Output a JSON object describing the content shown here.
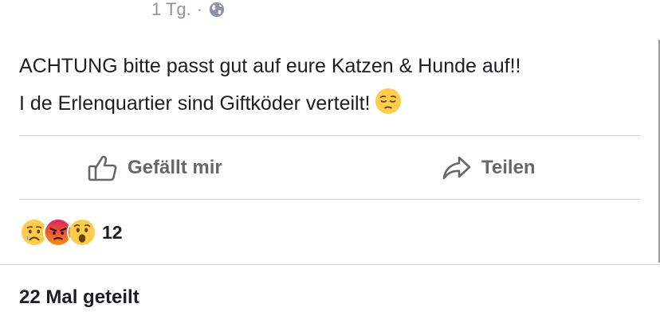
{
  "post": {
    "time": "1 Tg.",
    "separator": "·",
    "privacy_icon": "globe-icon",
    "text_line1": "ACHTUNG bitte passt gut auf eure Katzen & Hunde auf!!",
    "text_line2": "I de Erlenquartier sind Giftköder verteilt!",
    "text_emoji": "pensive-face-emoji"
  },
  "actions": {
    "like_label": "Gefällt mir",
    "like_icon": "thumbs-up-icon",
    "share_label": "Teilen",
    "share_icon": "share-arrow-icon"
  },
  "reactions": {
    "icons": [
      "sad-reaction",
      "angry-reaction",
      "wow-reaction"
    ],
    "count": "12"
  },
  "shares": {
    "label": "22 Mal geteilt"
  },
  "colors": {
    "text": "#1c1e21",
    "secondary": "#65676b",
    "meta": "#8d949e",
    "divider": "#ced0d4",
    "emoji_yellow": "#ffcc4d",
    "angry_red": "#e9710f"
  }
}
